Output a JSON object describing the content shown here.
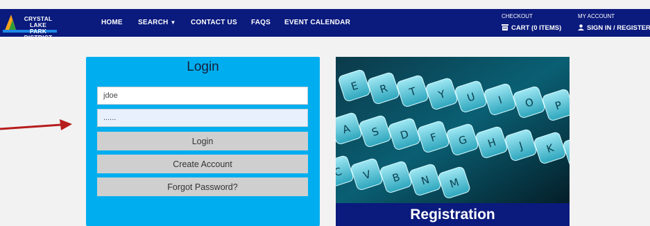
{
  "brand": {
    "line1": "CRYSTAL LAKE",
    "line2": "PARK DISTRICT"
  },
  "nav": {
    "home": "HOME",
    "search": "SEARCH",
    "contact": "CONTACT US",
    "faqs": "FAQS",
    "event_calendar": "EVENT CALENDAR",
    "checkout_label": "CHECKOUT",
    "cart": "CART (0 ITEMS)",
    "account_label": "MY ACCOUNT",
    "signin": "SIGN IN / REGISTER"
  },
  "login": {
    "title": "Login",
    "username_value": "jdoe",
    "password_value": "......",
    "login_button": "Login",
    "create_account_button": "Create Account",
    "forgot_password_button": "Forgot Password?"
  },
  "registration": {
    "label": "Registration",
    "keys": [
      "E",
      "R",
      "T",
      "Y",
      "U",
      "I",
      "O",
      "P",
      "A",
      "S",
      "D",
      "F",
      "G",
      "H",
      "J",
      "K",
      "L",
      "C",
      "V",
      "B",
      "N",
      "M"
    ]
  },
  "colors": {
    "nav_bg": "#0a1a7d",
    "login_bg": "#00aeef",
    "button_bg": "#cfcfcf",
    "arrow": "#b71c1c"
  },
  "icons": {
    "cart": "cart-icon",
    "user": "user-icon",
    "dropdown": "caret-down-icon"
  }
}
